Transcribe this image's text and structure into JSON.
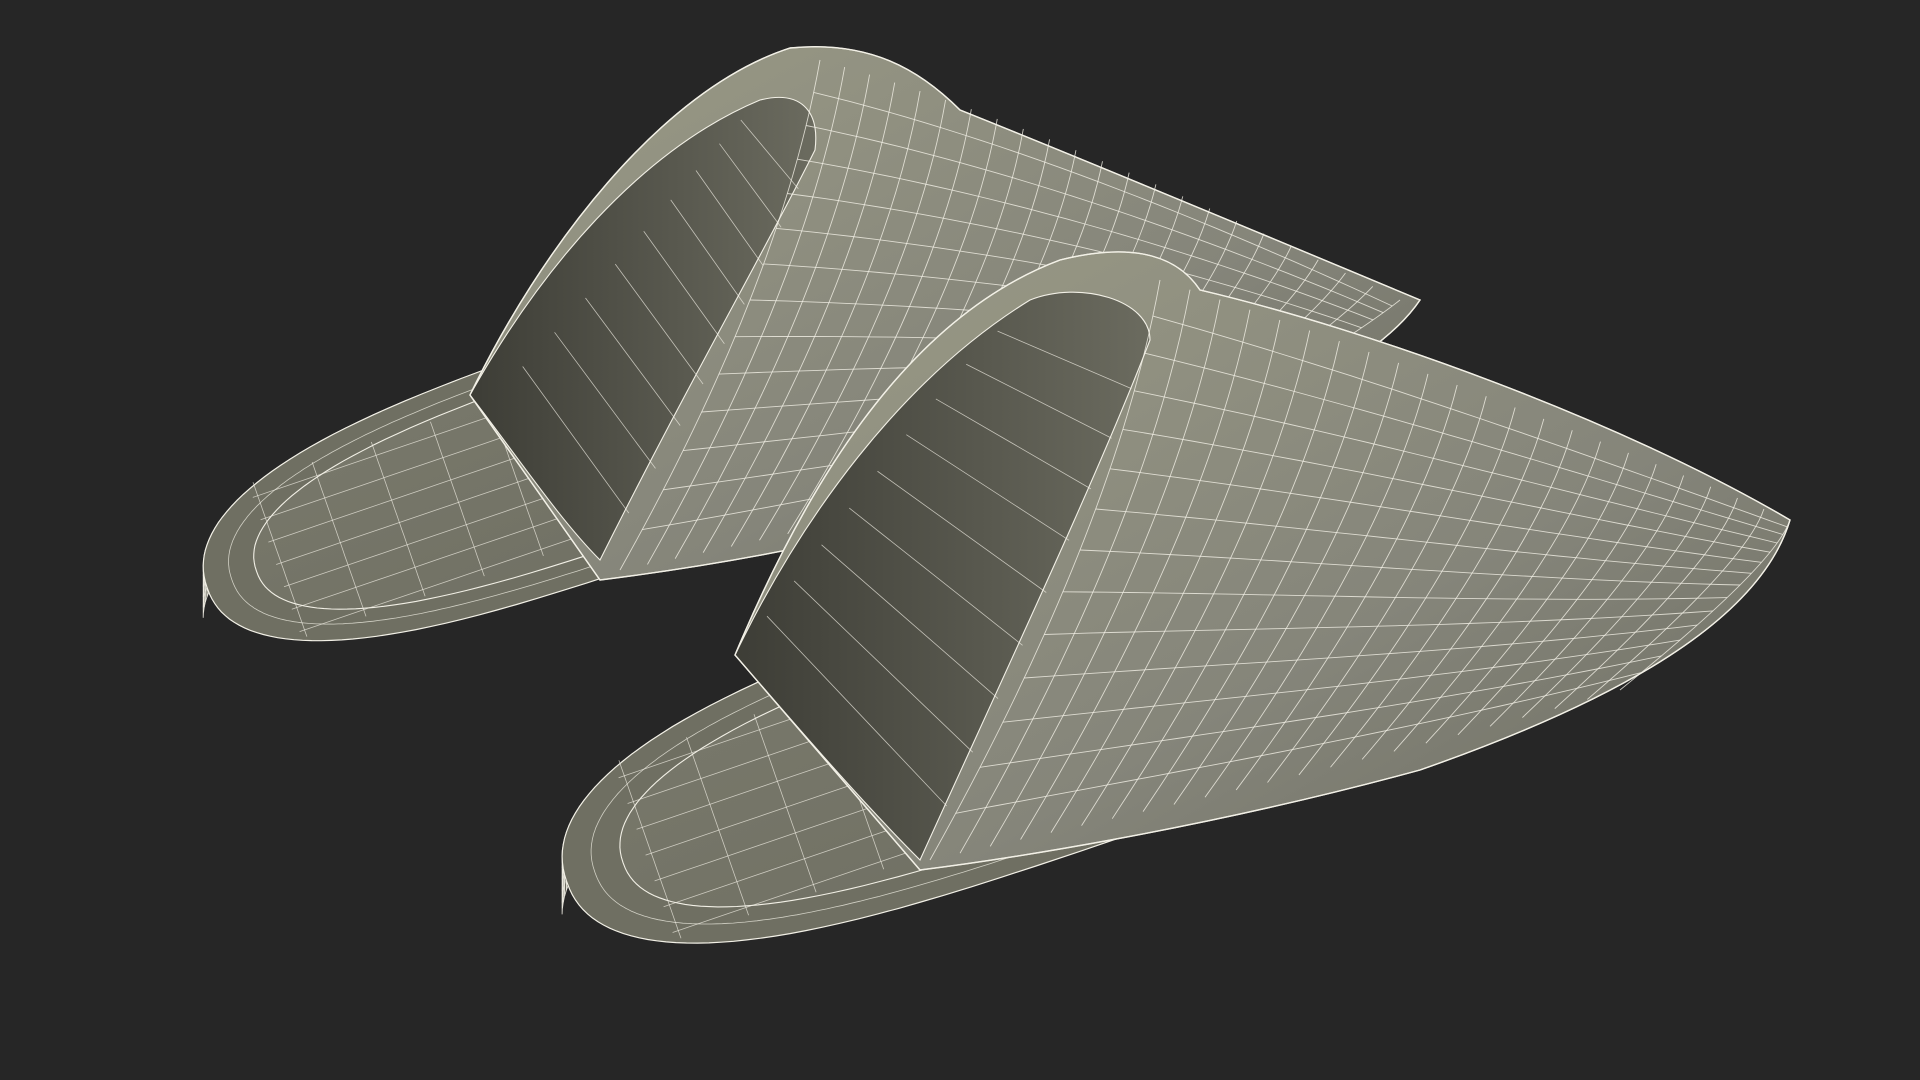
{
  "scene": {
    "background": "#262626",
    "colors": {
      "surface": "#7f7f72",
      "surface_light": "#93937f",
      "surface_dark": "#5a5a50",
      "rim": "#6f6f62",
      "wire": "#f2f0e6",
      "inner_shadow": "#3c3c35"
    },
    "objects": [
      {
        "name": "back-slipper",
        "type": "open-toe slipper",
        "render_mode": "wireframe-over-shaded"
      },
      {
        "name": "front-slipper",
        "type": "open-toe slipper",
        "render_mode": "wireframe-over-shaded"
      }
    ]
  }
}
